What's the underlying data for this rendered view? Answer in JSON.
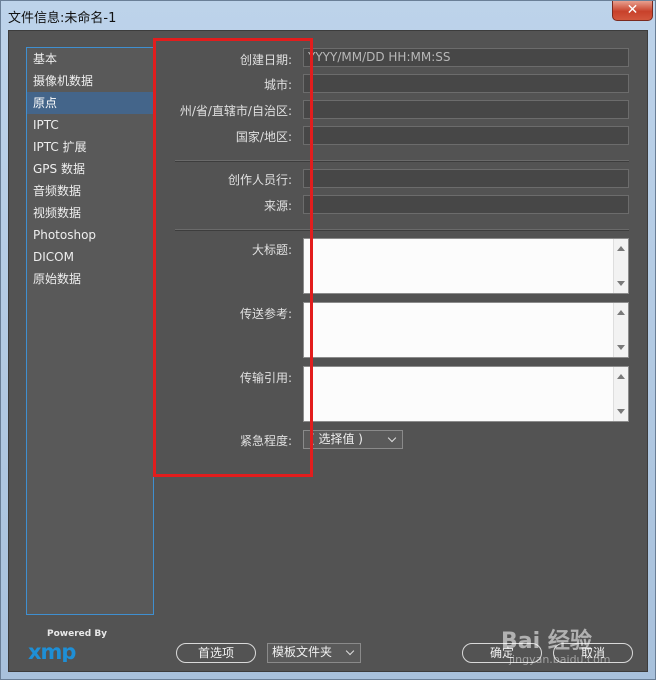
{
  "window": {
    "title": "文件信息:未命名-1",
    "close_label": "✕"
  },
  "sidebar": {
    "items": [
      {
        "label": "基本"
      },
      {
        "label": "摄像机数据"
      },
      {
        "label": "原点"
      },
      {
        "label": "IPTC"
      },
      {
        "label": "IPTC 扩展"
      },
      {
        "label": "GPS 数据"
      },
      {
        "label": "音频数据"
      },
      {
        "label": "视频数据"
      },
      {
        "label": "Photoshop"
      },
      {
        "label": "DICOM"
      },
      {
        "label": "原始数据"
      }
    ],
    "active_index": 2
  },
  "form": {
    "date_created_label": "创建日期:",
    "date_created_placeholder": "YYYY/MM/DD HH:MM:SS",
    "city_label": "城市:",
    "state_label": "州/省/直辖市/自治区:",
    "country_label": "国家/地区:",
    "credit_line_label": "创作人员行:",
    "source_label": "来源:",
    "headline_label": "大标题:",
    "transmission_ref_label": "传送参考:",
    "instructions_label": "传输引用:",
    "urgency_label": "紧急程度:",
    "urgency_value": "( 选择值 )"
  },
  "footer": {
    "powered_by": "Powered By",
    "xmp_logo": "xmp",
    "preferences_label": "首选项",
    "template_folder_label": "模板文件夹",
    "ok_label": "确定",
    "cancel_label": "取消"
  },
  "watermark": {
    "brand": "Bai 经验",
    "url": "jingyan.baidu.com"
  },
  "colors": {
    "highlight_box": "#e21d1d",
    "selected_item": "#44658a",
    "xmp_blue": "#1e8fd6"
  }
}
